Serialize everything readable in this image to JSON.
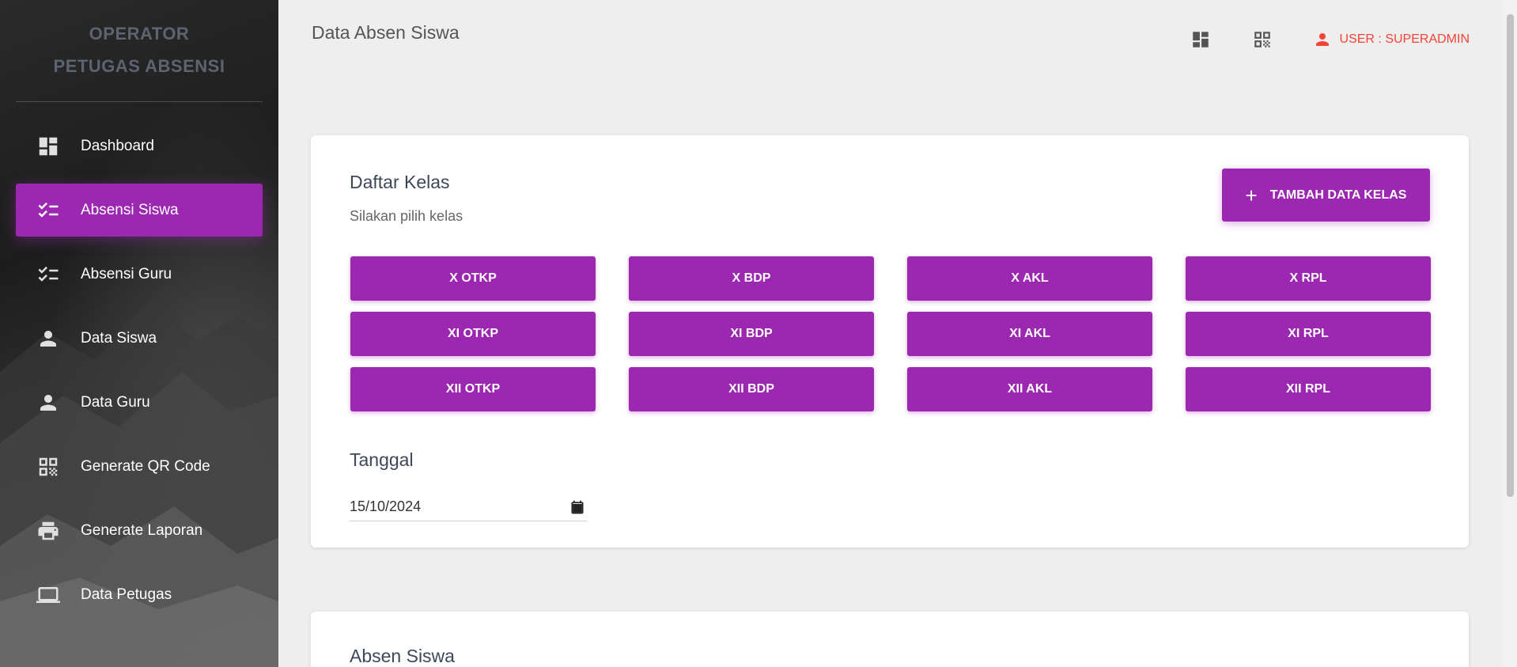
{
  "brand": {
    "line1": "OPERATOR",
    "line2": "PETUGAS ABSENSI"
  },
  "sidebar": {
    "items": [
      {
        "label": "Dashboard",
        "icon": "dashboard-icon",
        "active": false
      },
      {
        "label": "Absensi Siswa",
        "icon": "checklist-icon",
        "active": true
      },
      {
        "label": "Absensi Guru",
        "icon": "checklist-icon",
        "active": false
      },
      {
        "label": "Data Siswa",
        "icon": "person-icon",
        "active": false
      },
      {
        "label": "Data Guru",
        "icon": "person-icon",
        "active": false
      },
      {
        "label": "Generate QR Code",
        "icon": "qr-code-icon",
        "active": false
      },
      {
        "label": "Generate Laporan",
        "icon": "printer-icon",
        "active": false
      },
      {
        "label": "Data Petugas",
        "icon": "laptop-icon",
        "active": false
      }
    ]
  },
  "header": {
    "title": "Data Absen Siswa",
    "icons": [
      "dashboard-icon",
      "qr-code-icon"
    ],
    "user_label": "USER : SUPERADMIN"
  },
  "kelas_card": {
    "title": "Daftar Kelas",
    "subtitle": "Silakan pilih kelas",
    "add_button": "TAMBAH DATA KELAS",
    "classes": [
      "X OTKP",
      "X BDP",
      "X AKL",
      "X RPL",
      "XI OTKP",
      "XI BDP",
      "XI AKL",
      "XI RPL",
      "XII OTKP",
      "XII BDP",
      "XII AKL",
      "XII RPL"
    ],
    "date_label": "Tanggal",
    "date_value": "15/10/2024"
  },
  "absen_card": {
    "title": "Absen Siswa"
  },
  "colors": {
    "accent": "#9c27b0",
    "user": "#f44336",
    "background": "#eeeeee"
  }
}
